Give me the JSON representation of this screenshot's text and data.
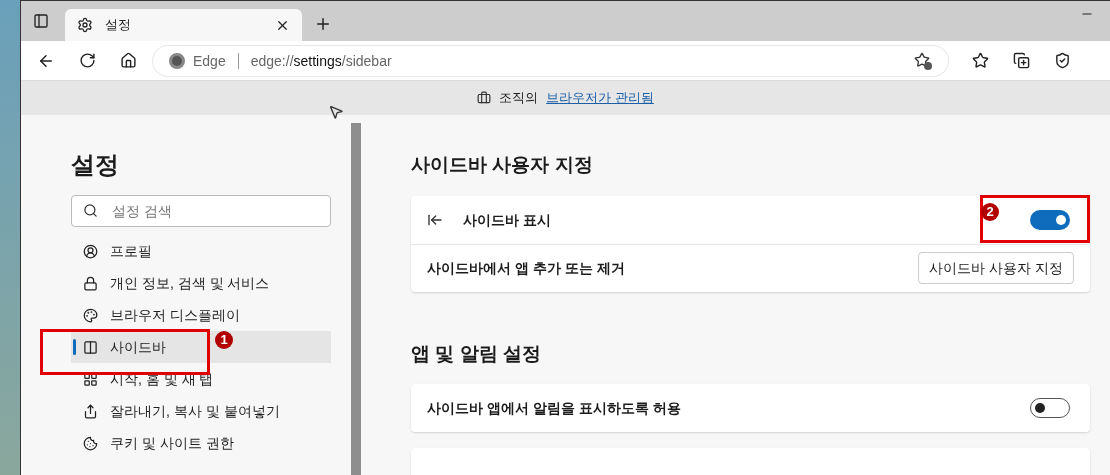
{
  "tab": {
    "title": "설정"
  },
  "address_bar": {
    "site_label": "Edge",
    "url_scheme": "edge://",
    "url_host": "settings",
    "url_path": "/sidebar"
  },
  "info_bar": {
    "text": "조직의",
    "link": "브라우저가 관리됨"
  },
  "sidebar": {
    "title": "설정",
    "search": {
      "placeholder": "설정 검색"
    },
    "items": [
      {
        "label": "프로필",
        "selected": false
      },
      {
        "label": "개인 정보, 검색 및 서비스",
        "selected": false
      },
      {
        "label": "브라우저 디스플레이",
        "selected": false
      },
      {
        "label": "사이드바",
        "selected": true
      },
      {
        "label": "시작, 홈 및 새 탭",
        "selected": false
      },
      {
        "label": "잘라내기, 복사 및 붙여넣기",
        "selected": false
      },
      {
        "label": "쿠키 및 사이트 권한",
        "selected": false
      }
    ]
  },
  "sections": [
    {
      "title": "사이드바 사용자 지정",
      "rows": [
        {
          "kind": "icon-toggle",
          "label": "사이드바 표시",
          "on": true
        },
        {
          "kind": "button",
          "label": "사이드바에서 앱 추가 또는 제거",
          "button": "사이드바 사용자 지정"
        }
      ]
    },
    {
      "title": "앱 및 알림 설정",
      "rows": [
        {
          "kind": "toggle",
          "label": "사이드바 앱에서 알림을 표시하도록 허용",
          "on": false
        }
      ]
    }
  ],
  "annotations": [
    {
      "number": "1"
    },
    {
      "number": "2"
    }
  ]
}
